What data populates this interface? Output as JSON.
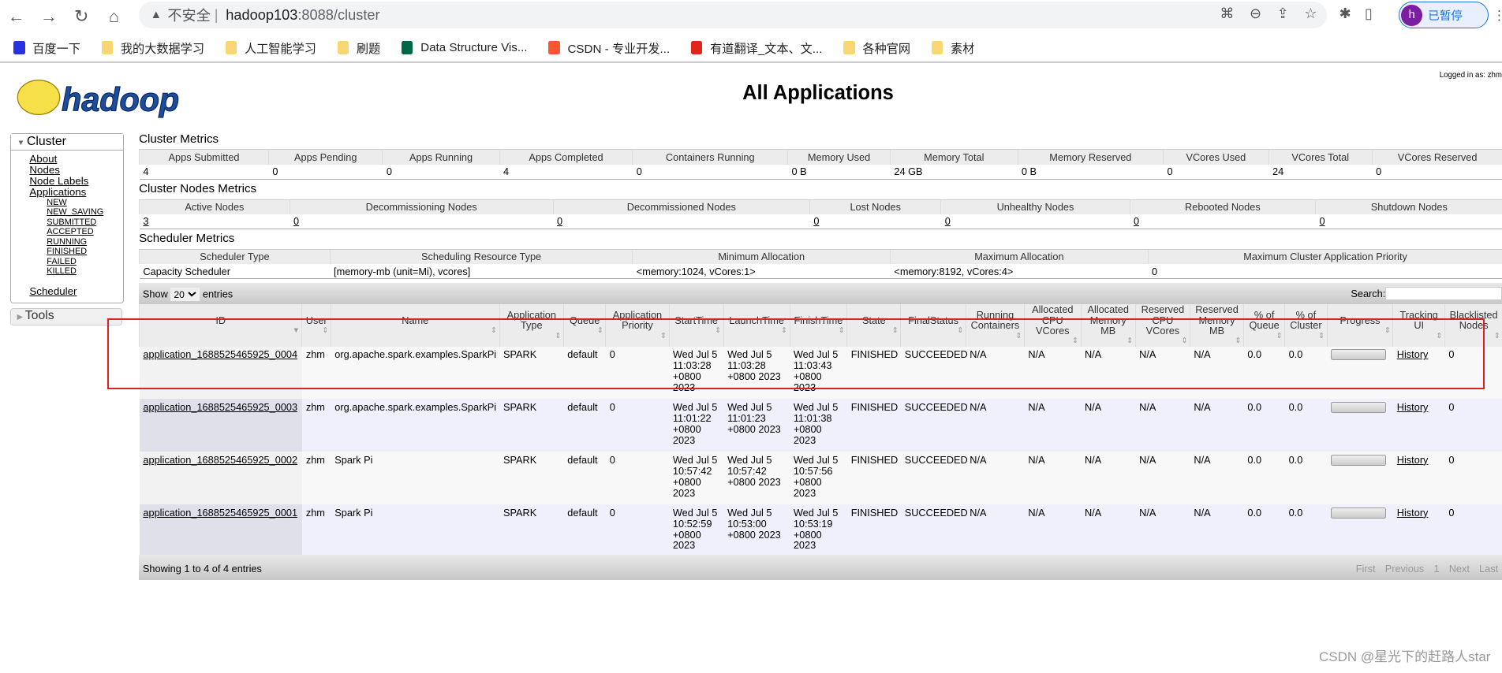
{
  "browser": {
    "insecure": "不安全",
    "host": "hadoop103",
    "path": ":8088/cluster",
    "profile_initial": "h",
    "profile_label": "已暂停",
    "bookmarks": [
      {
        "label": "百度一下",
        "icon": "baidu-icon"
      },
      {
        "label": "我的大数据学习",
        "icon": "folder-icon"
      },
      {
        "label": "人工智能学习",
        "icon": "folder-icon"
      },
      {
        "label": "刷题",
        "icon": "folder-icon"
      },
      {
        "label": "Data Structure Vis...",
        "icon": "usf-icon"
      },
      {
        "label": "CSDN - 专业开发...",
        "icon": "csdn-icon"
      },
      {
        "label": "有道翻译_文本、文...",
        "icon": "youdao-icon"
      },
      {
        "label": "各种官网",
        "icon": "folder-icon"
      },
      {
        "label": "素材",
        "icon": "folder-icon"
      }
    ]
  },
  "header": {
    "logged_in": "Logged in as: zhm",
    "title": "All Applications",
    "logo": "hadoop"
  },
  "sidebar": {
    "cluster": "Cluster",
    "links": [
      "About",
      "Nodes",
      "Node Labels",
      "Applications"
    ],
    "app_states": [
      "NEW",
      "NEW_SAVING",
      "SUBMITTED",
      "ACCEPTED",
      "RUNNING",
      "FINISHED",
      "FAILED",
      "KILLED"
    ],
    "scheduler": "Scheduler",
    "tools": "Tools"
  },
  "cluster_metrics": {
    "title": "Cluster Metrics",
    "headers": [
      "Apps Submitted",
      "Apps Pending",
      "Apps Running",
      "Apps Completed",
      "Containers Running",
      "Memory Used",
      "Memory Total",
      "Memory Reserved",
      "VCores Used",
      "VCores Total",
      "VCores Reserved"
    ],
    "values": [
      "4",
      "0",
      "0",
      "4",
      "0",
      "0 B",
      "24 GB",
      "0 B",
      "0",
      "24",
      "0"
    ]
  },
  "node_metrics": {
    "title": "Cluster Nodes Metrics",
    "headers": [
      "Active Nodes",
      "Decommissioning Nodes",
      "Decommissioned Nodes",
      "Lost Nodes",
      "Unhealthy Nodes",
      "Rebooted Nodes",
      "Shutdown Nodes"
    ],
    "values": [
      "3",
      "0",
      "0",
      "0",
      "0",
      "0",
      "0"
    ]
  },
  "scheduler_metrics": {
    "title": "Scheduler Metrics",
    "headers": [
      "Scheduler Type",
      "Scheduling Resource Type",
      "Minimum Allocation",
      "Maximum Allocation",
      "Maximum Cluster Application Priority"
    ],
    "values": [
      "Capacity Scheduler",
      "[memory-mb (unit=Mi), vcores]",
      "<memory:1024, vCores:1>",
      "<memory:8192, vCores:4>",
      "0"
    ]
  },
  "datatable": {
    "show": "Show",
    "entries_value": "20",
    "entries": "entries",
    "search": "Search:",
    "info": "Showing 1 to 4 of 4 entries",
    "pager": [
      "First",
      "Previous",
      "1",
      "Next",
      "Last"
    ],
    "columns": [
      "ID",
      "User",
      "Name",
      "Application Type",
      "Queue",
      "Application Priority",
      "StartTime",
      "LaunchTime",
      "FinishTime",
      "State",
      "FinalStatus",
      "Running Containers",
      "Allocated CPU VCores",
      "Allocated Memory MB",
      "Reserved CPU VCores",
      "Reserved Memory MB",
      "% of Queue",
      "% of Cluster",
      "Progress",
      "Tracking UI",
      "Blacklisted Nodes"
    ],
    "rows": [
      [
        "application_1688525465925_0004",
        "zhm",
        "org.apache.spark.examples.SparkPi",
        "SPARK",
        "default",
        "0",
        "Wed Jul 5 11:03:28 +0800 2023",
        "Wed Jul 5 11:03:28 +0800 2023",
        "Wed Jul 5 11:03:43 +0800 2023",
        "FINISHED",
        "SUCCEEDED",
        "N/A",
        "N/A",
        "N/A",
        "N/A",
        "N/A",
        "0.0",
        "0.0",
        "",
        "History",
        "0"
      ],
      [
        "application_1688525465925_0003",
        "zhm",
        "org.apache.spark.examples.SparkPi",
        "SPARK",
        "default",
        "0",
        "Wed Jul 5 11:01:22 +0800 2023",
        "Wed Jul 5 11:01:23 +0800 2023",
        "Wed Jul 5 11:01:38 +0800 2023",
        "FINISHED",
        "SUCCEEDED",
        "N/A",
        "N/A",
        "N/A",
        "N/A",
        "N/A",
        "0.0",
        "0.0",
        "",
        "History",
        "0"
      ],
      [
        "application_1688525465925_0002",
        "zhm",
        "Spark Pi",
        "SPARK",
        "default",
        "0",
        "Wed Jul 5 10:57:42 +0800 2023",
        "Wed Jul 5 10:57:42 +0800 2023",
        "Wed Jul 5 10:57:56 +0800 2023",
        "FINISHED",
        "SUCCEEDED",
        "N/A",
        "N/A",
        "N/A",
        "N/A",
        "N/A",
        "0.0",
        "0.0",
        "",
        "History",
        "0"
      ],
      [
        "application_1688525465925_0001",
        "zhm",
        "Spark Pi",
        "SPARK",
        "default",
        "0",
        "Wed Jul 5 10:52:59 +0800 2023",
        "Wed Jul 5 10:53:00 +0800 2023",
        "Wed Jul 5 10:53:19 +0800 2023",
        "FINISHED",
        "SUCCEEDED",
        "N/A",
        "N/A",
        "N/A",
        "N/A",
        "N/A",
        "0.0",
        "0.0",
        "",
        "History",
        "0"
      ]
    ],
    "progress": [
      100,
      100,
      100,
      100
    ]
  },
  "highlight_color": "#e02020",
  "watermark": "CSDN @星光下的赶路人star"
}
